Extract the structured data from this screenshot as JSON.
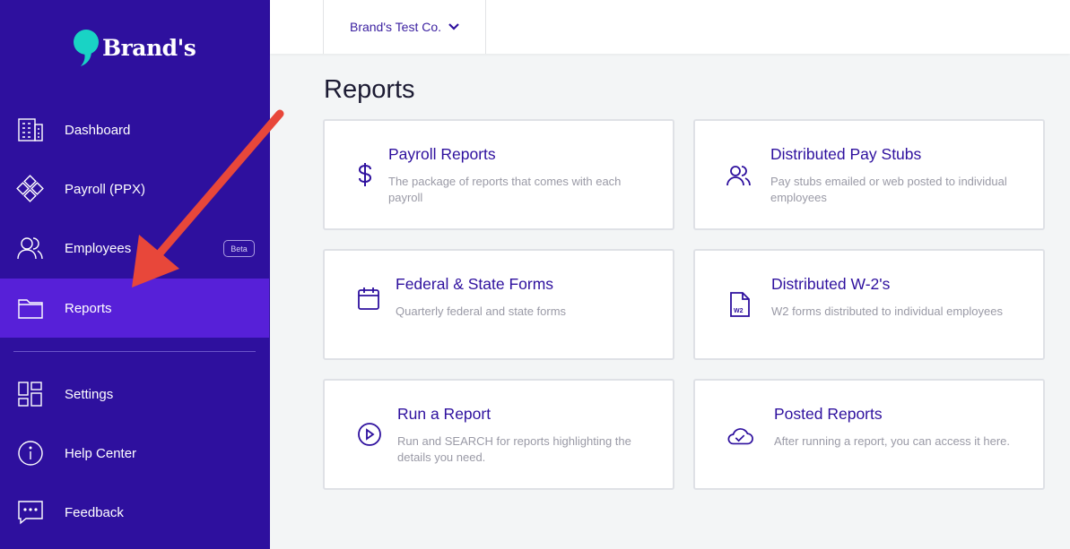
{
  "brand": {
    "name": "Brand's"
  },
  "sidebar": {
    "items": [
      {
        "label": "Dashboard",
        "icon": "building-icon"
      },
      {
        "label": "Payroll (PPX)",
        "icon": "diamond-cluster-icon"
      },
      {
        "label": "Employees",
        "icon": "people-icon",
        "badge": "Beta"
      },
      {
        "label": "Reports",
        "icon": "folder-icon",
        "active": true
      },
      {
        "label": "Settings",
        "icon": "grid-icon"
      },
      {
        "label": "Help Center",
        "icon": "info-icon"
      },
      {
        "label": "Feedback",
        "icon": "chat-icon"
      }
    ]
  },
  "topbar": {
    "company": "Brand's Test Co."
  },
  "main": {
    "title": "Reports",
    "cards": [
      {
        "title": "Payroll Reports",
        "desc": "The package of reports that comes with each payroll",
        "icon": "dollar-icon"
      },
      {
        "title": "Distributed Pay Stubs",
        "desc": "Pay stubs emailed or web posted to individual employees",
        "icon": "people-icon"
      },
      {
        "title": "Federal & State Forms",
        "desc": "Quarterly federal and state forms",
        "icon": "calendar-icon"
      },
      {
        "title": "Distributed W-2's",
        "desc": "W2 forms distributed to individual employees",
        "icon": "w2-document-icon",
        "icon_text": "W2"
      },
      {
        "title": "Run a Report",
        "desc": "Run and SEARCH for reports highlighting the details you need.",
        "icon": "play-circle-icon"
      },
      {
        "title": "Posted Reports",
        "desc": "After running a report, you can access it here.",
        "icon": "cloud-check-icon"
      }
    ]
  },
  "colors": {
    "sidebar": "#2e109e",
    "active": "#5720d8",
    "accent": "#2e109e",
    "logo": "#19d3c5",
    "annotation": "#e8473a"
  }
}
